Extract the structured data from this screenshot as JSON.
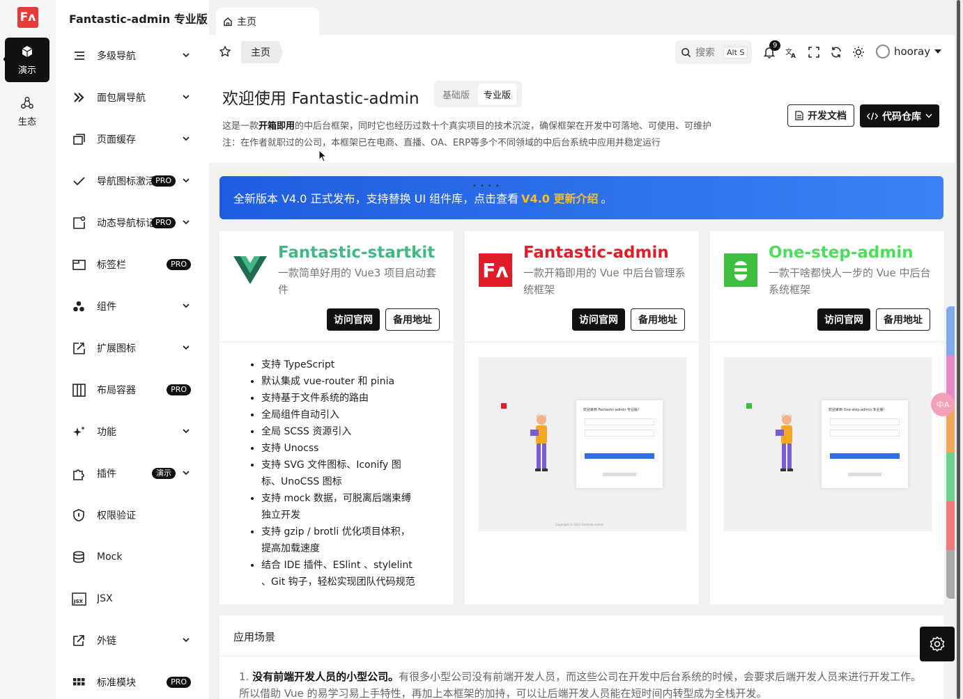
{
  "main_sidebar": {
    "logo": "Fʌ",
    "items": [
      {
        "label": "演示",
        "icon": "cube-icon",
        "active": true
      },
      {
        "label": "生态",
        "icon": "ecosystem-icon",
        "active": false
      }
    ]
  },
  "sub_sidebar": {
    "title": "Fantastic-admin 专业版",
    "items": [
      {
        "label": "多级导航",
        "icon": "list-icon",
        "badge": "",
        "chevron": true
      },
      {
        "label": "面包屑导航",
        "icon": "double-chevron-icon",
        "badge": "",
        "chevron": true
      },
      {
        "label": "页面缓存",
        "icon": "window-icon",
        "badge": "",
        "chevron": true
      },
      {
        "label": "导航图标激活",
        "icon": "check-icon",
        "badge": "PRO",
        "chevron": true
      },
      {
        "label": "动态导航标记",
        "icon": "badge-icon",
        "badge": "PRO",
        "chevron": true
      },
      {
        "label": "标签栏",
        "icon": "tab-icon",
        "badge": "PRO",
        "chevron": false
      },
      {
        "label": "组件",
        "icon": "components-icon",
        "badge": "",
        "chevron": true
      },
      {
        "label": "扩展图标",
        "icon": "extend-icon",
        "badge": "",
        "chevron": true
      },
      {
        "label": "布局容器",
        "icon": "layout-icon",
        "badge": "PRO",
        "chevron": false
      },
      {
        "label": "功能",
        "icon": "sparkle-icon",
        "badge": "",
        "chevron": true
      },
      {
        "label": "插件",
        "icon": "plugin-icon",
        "badge": "演示",
        "chevron": true
      },
      {
        "label": "权限验证",
        "icon": "shield-icon",
        "badge": "",
        "chevron": false
      },
      {
        "label": "Mock",
        "icon": "database-icon",
        "badge": "",
        "chevron": false
      },
      {
        "label": "JSX",
        "icon": "jsx-icon",
        "badge": "",
        "chevron": false
      },
      {
        "label": "外链",
        "icon": "external-link-icon",
        "badge": "",
        "chevron": true
      },
      {
        "label": "标准模块",
        "icon": "grid-icon",
        "badge": "PRO",
        "chevron": false
      }
    ]
  },
  "tabs": [
    {
      "label": "主页"
    }
  ],
  "toolbar": {
    "breadcrumb": "主页",
    "search_label": "搜索",
    "search_shortcut": "Alt S",
    "notification_count": "9",
    "username": "hooray"
  },
  "header": {
    "title": "欢迎使用 Fantastic-admin",
    "version_basic": "基础版",
    "version_pro": "专业版",
    "desc_line1_pre": "这是一款",
    "desc_line1_bold": "开箱即用",
    "desc_line1_post": "的中后台框架，同时它也经历过数十个真实项目的技术沉淀，确保框架在开发中可落地、可使用、可维护",
    "desc_line2": "注：在作者就职过的公司，本框架已在电商、直播、OA、ERP等多个不同领域的中后台系统中应用并稳定运行",
    "btn_docs": "开发文档",
    "btn_repo": "代码仓库"
  },
  "banner": {
    "text_pre": "全新版本 V4.0 正式发布，支持替换 UI 组件库，点击查看",
    "link": "V4.0 更新介绍",
    "text_post": "。"
  },
  "cards": [
    {
      "name": "Fantastic-startkit",
      "name_color": "#41b883",
      "desc": "一款简单好用的 Vue3 项目启动套件",
      "btn_primary": "访问官网",
      "btn_secondary": "备用地址",
      "features": [
        "支持 TypeScript",
        "默认集成 vue-router 和 pinia",
        "支持基于文件系统的路由",
        "全局组件自动引入",
        "全局 SCSS 资源引入",
        "支持 Unocss",
        "支持 SVG 文件图标、Iconify 图标、UnoCSS 图标",
        "支持 mock 数据，可脱离后端束缚独立开发",
        "支持 gzip / brotli 优化项目体积，提高加载速度",
        "结合 IDE 插件、ESlint 、stylelint 、Git 钩子，轻松实现团队代码规范"
      ]
    },
    {
      "name": "Fantastic-admin",
      "name_color": "#e11d2a",
      "desc": "一款开箱即用的 Vue 中后台管理系统框架",
      "btn_primary": "访问官网",
      "btn_secondary": "备用地址",
      "preview_title": "欢迎来到 Fantastic-admin 专业版！",
      "preview_footer": "Copyright © 2023 Fantastic-admin"
    },
    {
      "name": "One-step-admin",
      "name_color": "#4ade5a",
      "desc": "一款干啥都快人一步的 Vue 中后台系统框架",
      "btn_primary": "访问官网",
      "btn_secondary": "备用地址",
      "preview_title": "欢迎来到 One-step-admin 专业版！"
    }
  ],
  "scene": {
    "title": "应用场景",
    "item_index": "1.",
    "item_bold": "没有前端开发人员的小型公司。",
    "item_text": "有很多小型公司没有前端开发人员，而这些公司在开发中后台系统的时候，会要求后端开发人员来进行开发工作。所以借助 Vue 的易学习易上手特性，再加上本框架的加持，可以让后端开发人员能在短时间内转型成为全栈开发。"
  },
  "lang_bubble": "中A",
  "colors": {
    "accent": "#111111",
    "banner_start": "#1e5de0",
    "banner_end": "#3b82f6",
    "banner_link": "#fbbf24",
    "logo_red": "#e83a3a"
  }
}
